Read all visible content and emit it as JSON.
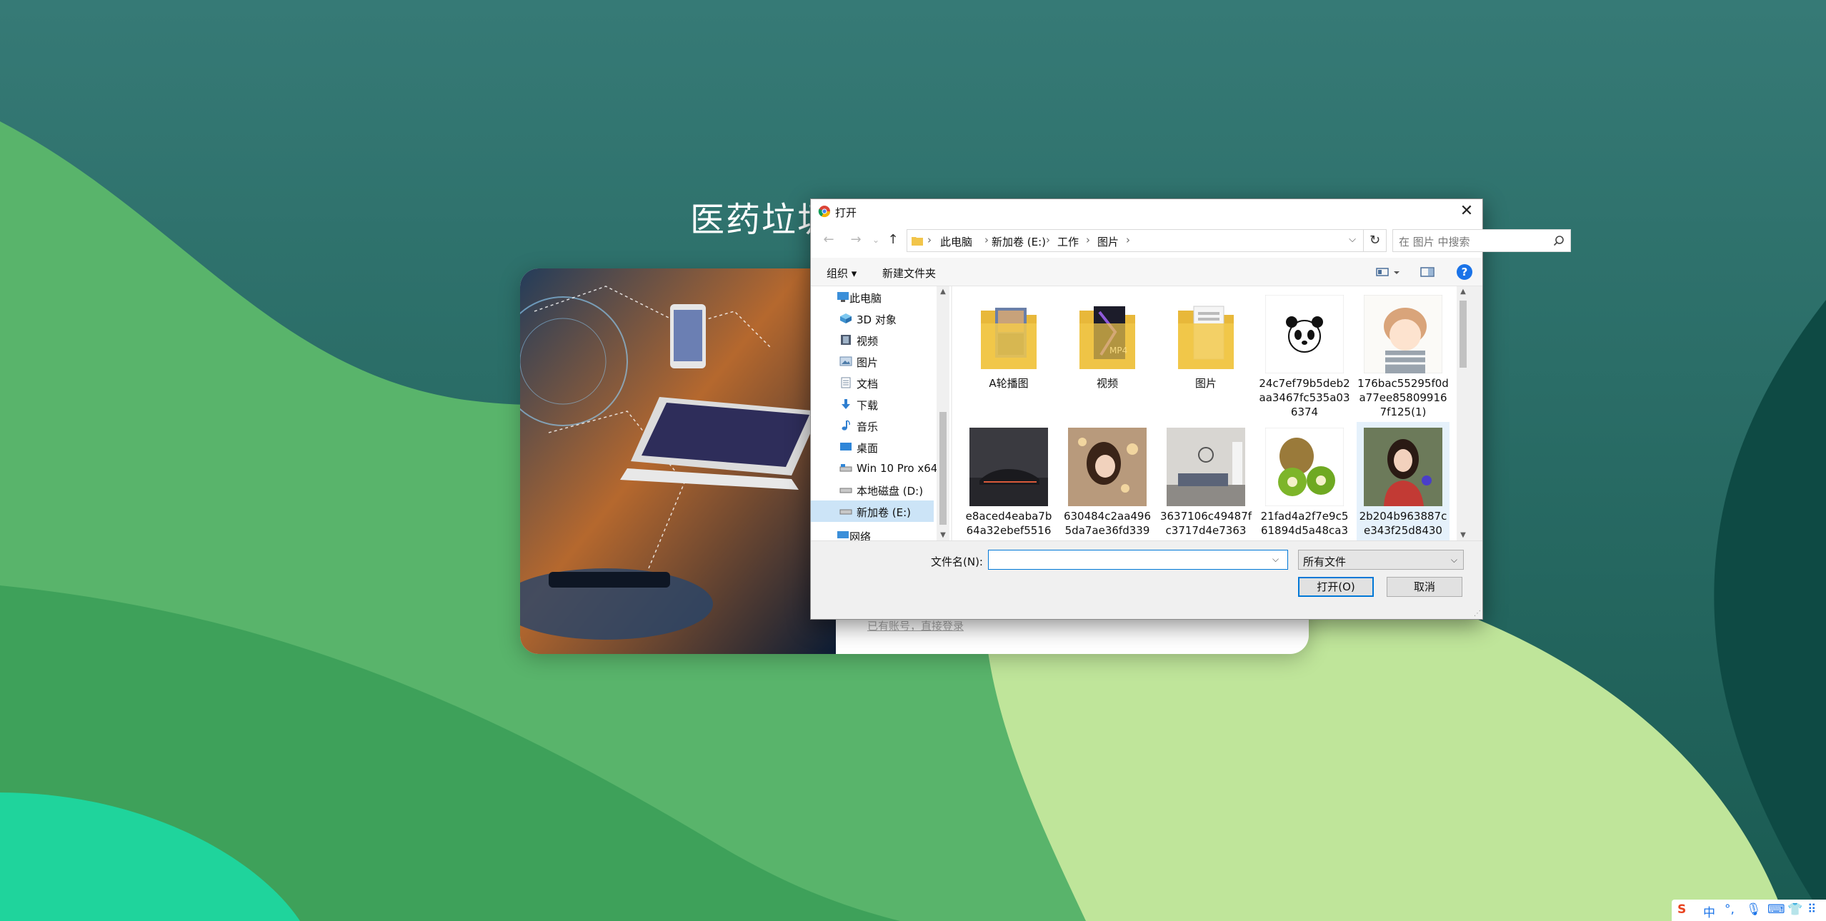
{
  "page": {
    "title": "医药垃圾",
    "login_link": "已有账号，直接登录"
  },
  "dialog": {
    "title": "打开",
    "breadcrumb": [
      "此电脑",
      "新加卷 (E:)",
      "工作",
      "图片"
    ],
    "search_placeholder": "在 图片 中搜索",
    "toolbar": {
      "organize": "组织 ▾",
      "new_folder": "新建文件夹",
      "help": "?"
    },
    "nav_items": [
      {
        "label": "此电脑",
        "icon": "computer-icon"
      },
      {
        "label": "3D 对象",
        "icon": "cube-icon"
      },
      {
        "label": "视频",
        "icon": "video-icon"
      },
      {
        "label": "图片",
        "icon": "picture-icon"
      },
      {
        "label": "文档",
        "icon": "document-icon"
      },
      {
        "label": "下载",
        "icon": "download-icon"
      },
      {
        "label": "音乐",
        "icon": "music-icon"
      },
      {
        "label": "桌面",
        "icon": "desktop-icon"
      },
      {
        "label": "Win 10 Pro x64",
        "icon": "drive-icon"
      },
      {
        "label": "本地磁盘 (D:)",
        "icon": "drive-icon"
      },
      {
        "label": "新加卷 (E:)",
        "icon": "drive-icon"
      },
      {
        "label": "网络",
        "icon": "network-icon"
      }
    ],
    "files": [
      {
        "name": "A轮播图",
        "kind": "folder"
      },
      {
        "name": "视频",
        "kind": "folder"
      },
      {
        "name": "图片",
        "kind": "folder"
      },
      {
        "name": "24c7ef79b5deb2aa3467fc535a036374",
        "kind": "image"
      },
      {
        "name": "176bac55295f0da77ee858099167f125(1)",
        "kind": "image"
      },
      {
        "name": "e8aced4eaba7b64a32ebef5516",
        "kind": "image"
      },
      {
        "name": "630484c2aa4965da7ae36fd339",
        "kind": "image"
      },
      {
        "name": "3637106c49487fc3717d4e7363",
        "kind": "image"
      },
      {
        "name": "21fad4a2f7e9c561894d5a48ca3",
        "kind": "image"
      },
      {
        "name": "2b204b963887ce343f25d8430",
        "kind": "image"
      }
    ],
    "filename_label": "文件名(N):",
    "filename_value": "",
    "filetype": "所有文件",
    "open_button": "打开(O)",
    "cancel_button": "取消"
  },
  "tray": {
    "ime": "中",
    "punct": "°,"
  }
}
